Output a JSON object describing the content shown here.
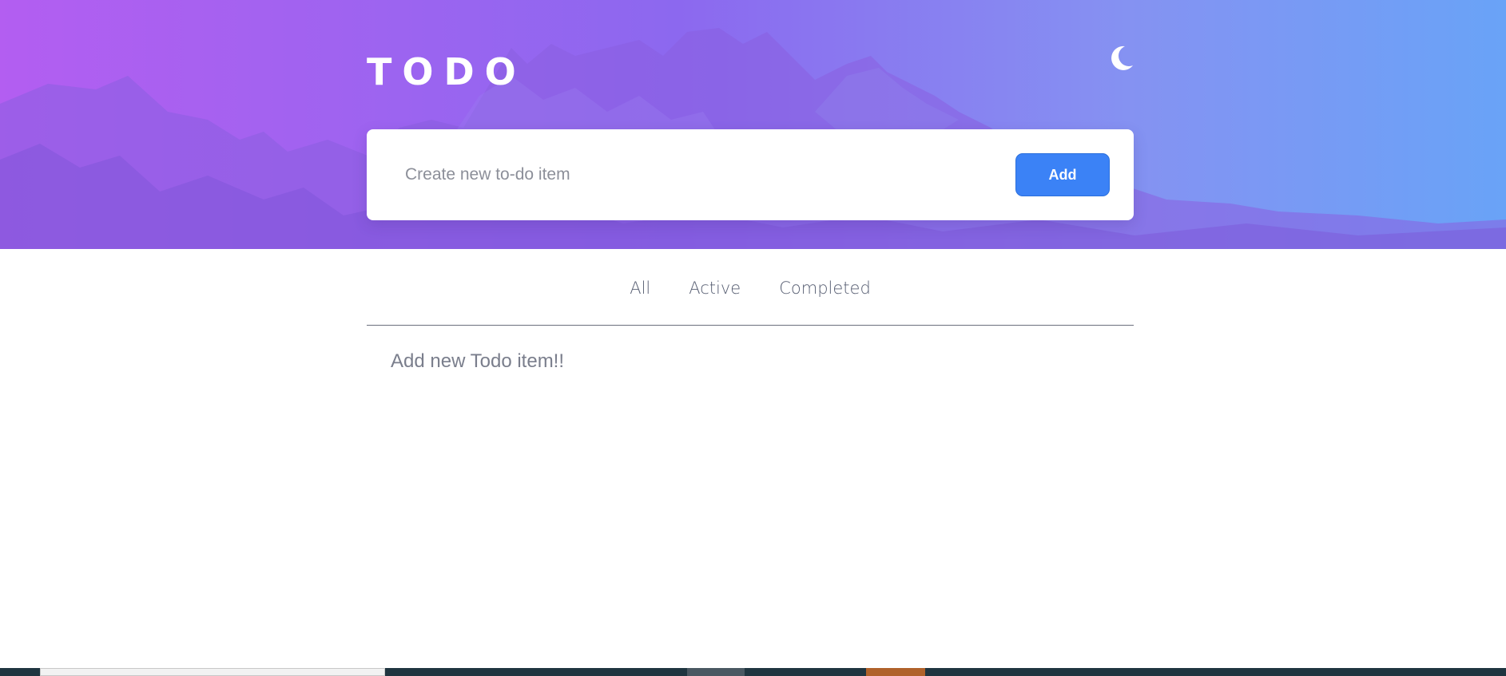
{
  "app": {
    "title": "TODO"
  },
  "theme_toggle": {
    "icon": "moon-icon"
  },
  "new_todo": {
    "placeholder": "Create new to-do item",
    "value": "",
    "add_label": "Add"
  },
  "filters": {
    "tabs": [
      {
        "label": "All"
      },
      {
        "label": "Active"
      },
      {
        "label": "Completed"
      }
    ]
  },
  "todo_list": {
    "empty_message": "Add new Todo item!!"
  },
  "colors": {
    "accent": "#3b82f6",
    "hero_gradient_start": "#b05cf0",
    "hero_gradient_end": "#6aa0f6"
  }
}
